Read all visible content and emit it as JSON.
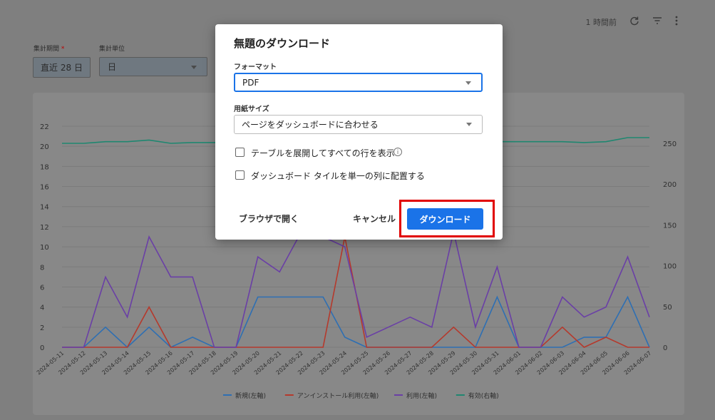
{
  "topbar": {
    "ago": "1 時間前"
  },
  "filters": {
    "period_label": "集計期間",
    "period_required": "*",
    "period_value": "直近 28 日",
    "unit_label": "集計単位",
    "unit_value": "日"
  },
  "dialog": {
    "title": "無題のダウンロード",
    "format_label": "フォーマット",
    "format_value": "PDF",
    "paper_label": "用紙サイズ",
    "paper_value": "ページをダッシュボードに合わせる",
    "expand_tables_label": "テーブルを展開してすべての行を表示",
    "single_column_label": "ダッシュボード タイルを単一の列に配置する",
    "open_in_browser": "ブラウザで開く",
    "cancel": "キャンセル",
    "download": "ダウンロード"
  },
  "colors": {
    "new": "#2e6fb3",
    "uninstall": "#b5392c",
    "usage": "#6a3fa6",
    "active": "#1f8770",
    "accent": "#1a73e8",
    "highlight": "#e10000"
  },
  "chart_data": {
    "type": "line",
    "x": [
      "2024-05-11",
      "2024-05-12",
      "2024-05-13",
      "2024-05-14",
      "2024-05-15",
      "2024-05-16",
      "2024-05-17",
      "2024-05-18",
      "2024-05-19",
      "2024-05-20",
      "2024-05-21",
      "2024-05-22",
      "2024-05-23",
      "2024-05-24",
      "2024-05-25",
      "2024-05-26",
      "2024-05-27",
      "2024-05-28",
      "2024-05-29",
      "2024-05-30",
      "2024-05-31",
      "2024-06-01",
      "2024-06-02",
      "2024-06-03",
      "2024-06-04",
      "2024-06-05",
      "2024-06-06",
      "2024-06-07"
    ],
    "y_left_ticks": [
      "0",
      "2",
      "4",
      "6",
      "8",
      "10",
      "12",
      "14",
      "16",
      "18",
      "20",
      "22"
    ],
    "y_right_ticks": [
      "0",
      "50",
      "100",
      "150",
      "200",
      "250"
    ],
    "ylim_left": [
      0,
      22
    ],
    "ylim_right": [
      0,
      250
    ],
    "series": [
      {
        "name": "新規(左軸)",
        "axis": "left",
        "color": "#2e6fb3",
        "values": [
          0,
          0,
          2,
          0,
          2,
          0,
          1,
          0,
          0,
          5,
          5,
          5,
          5,
          1,
          0,
          0,
          0,
          0,
          0,
          0,
          5,
          0,
          0,
          0,
          1,
          1,
          5,
          0
        ]
      },
      {
        "name": "アンインストール利用(左軸)",
        "axis": "left",
        "color": "#b5392c",
        "values": [
          0,
          0,
          0,
          0,
          4,
          0,
          0,
          0,
          0,
          0,
          0,
          0,
          0,
          11,
          0,
          0,
          0,
          0,
          2,
          0,
          0,
          0,
          0,
          2,
          0,
          1,
          0,
          0
        ]
      },
      {
        "name": "利用(左軸)",
        "axis": "left",
        "color": "#6a3fa6",
        "values": [
          0,
          0,
          7,
          3,
          11,
          7,
          7,
          0,
          0,
          9,
          7.5,
          11.5,
          11,
          10,
          1,
          2,
          3,
          2,
          11.5,
          2,
          8,
          0,
          0,
          5,
          3,
          4,
          9,
          3
        ]
      },
      {
        "name": "有効(右軸)",
        "axis": "right",
        "color": "#1f8770",
        "values": [
          250,
          250,
          252,
          252,
          254,
          250,
          251,
          251,
          252,
          252,
          252,
          252,
          252,
          252,
          252,
          252,
          252,
          252,
          252,
          252,
          252,
          252,
          252,
          252,
          251,
          252,
          257,
          257
        ]
      }
    ]
  }
}
